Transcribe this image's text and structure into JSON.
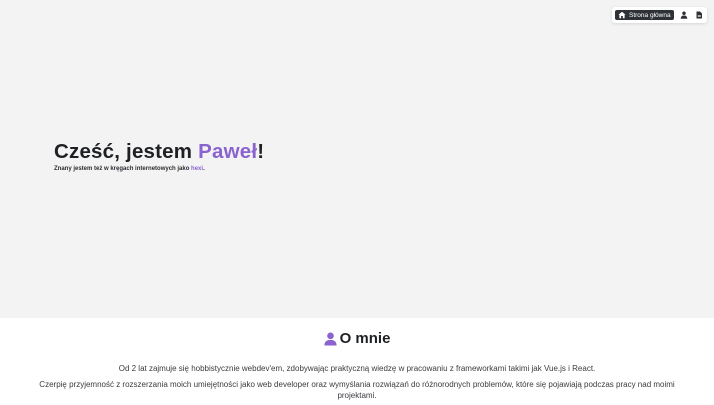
{
  "nav": {
    "home_label": "Strona główna",
    "icons": [
      "home-icon",
      "user-icon",
      "document-icon"
    ]
  },
  "hero": {
    "title_prefix": "Cześć, jestem ",
    "title_name": "Paweł",
    "title_suffix": "!",
    "subtitle_prefix": "Znany jestem też w kręgach internetowych jako ",
    "subtitle_nick": "hexi",
    "subtitle_suffix": "."
  },
  "about": {
    "heading": "O mnie",
    "paragraph1": "Od 2 lat zajmuje się hobbistycznie webdev'em, zdobywając praktyczną wiedzę w pracowaniu z frameworkami takimi jak Vue.js i React.",
    "paragraph2": "Czerpię przyjemność z rozszerzania moich umiejętności jako web developer oraz wymyślania rozwiązań do różnorodnych problemów, które się pojawiają podczas pracy nad moimi projektami."
  },
  "colors": {
    "accent": "#8a63cf",
    "hero_background": "#f3f3f4",
    "nav_button_background": "#2e3237"
  }
}
